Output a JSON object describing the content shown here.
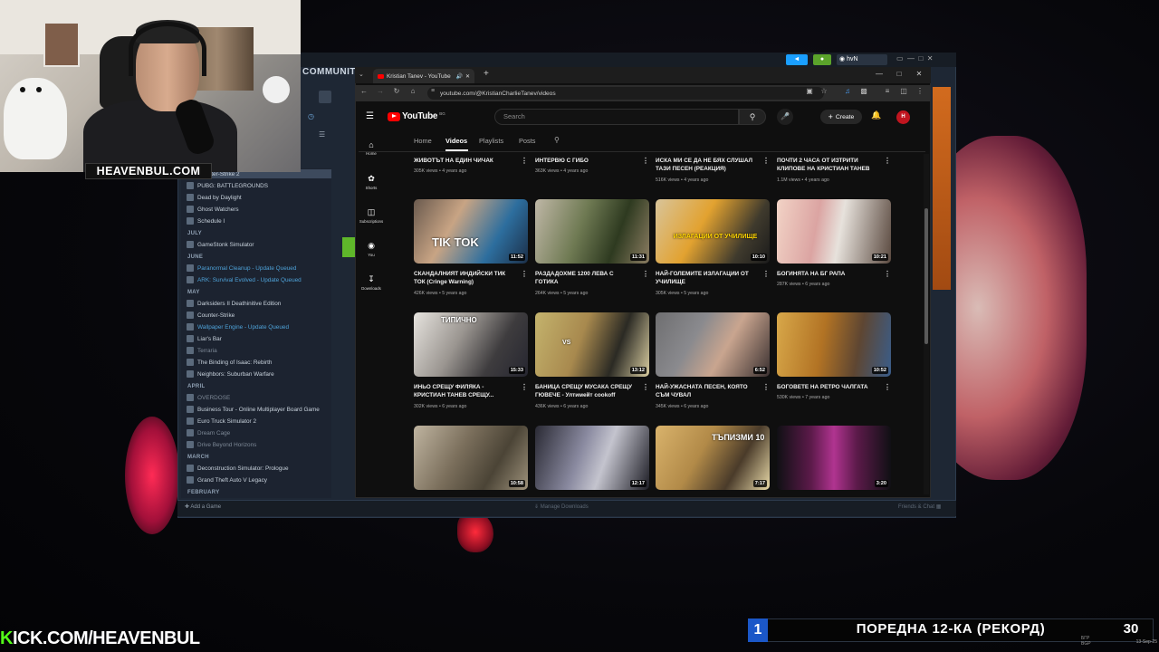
{
  "steam": {
    "top_label": "COMMUNITY",
    "top_label_2": "H",
    "tray_user": "hvN",
    "add_game": "Add a Game",
    "manage_downloads": "Manage Downloads",
    "friends_chat": "Friends & Chat",
    "sections": {
      "july": "JULY",
      "june": "JUNE",
      "may": "MAY",
      "april": "APRIL",
      "march": "MARCH",
      "february": "FEBRUARY"
    },
    "games": [
      {
        "label": "Counter-Strike 2"
      },
      {
        "label": "PUBG: BATTLEGROUNDS"
      },
      {
        "label": "Dead by Daylight"
      },
      {
        "label": "Ghost Watchers"
      },
      {
        "label": "Schedule I"
      },
      {
        "label": "GameStonk Simulator"
      },
      {
        "label": "Paranormal Cleanup - Update Queued"
      },
      {
        "label": "ARK: Survival Evolved - Update Queued"
      },
      {
        "label": "Darksiders II Deathinitive Edition"
      },
      {
        "label": "Counter-Strike"
      },
      {
        "label": "Wallpaper Engine - Update Queued"
      },
      {
        "label": "Liar's Bar"
      },
      {
        "label": "Terraria"
      },
      {
        "label": "The Binding of Isaac: Rebirth"
      },
      {
        "label": "Neighbors: Suburban Warfare"
      },
      {
        "label": "OVERDOSE"
      },
      {
        "label": "Business Tour - Online Multiplayer Board Game"
      },
      {
        "label": "Euro Truck Simulator 2"
      },
      {
        "label": "Dream Cage"
      },
      {
        "label": "Drive Beyond Horizons"
      },
      {
        "label": "Deconstruction Simulator: Prologue"
      },
      {
        "label": "Grand Theft Auto V Legacy"
      }
    ]
  },
  "browser": {
    "tab_title": "Kristian Tanev - YouTube",
    "url": "youtube.com/@KristianCharlieTanev/videos"
  },
  "youtube": {
    "logo_text": "YouTube",
    "country": "BG",
    "search_placeholder": "Search",
    "create_label": "Create",
    "avatar_letter": "H",
    "rail": {
      "home": "Home",
      "shorts": "Shorts",
      "subscriptions": "Subscriptions",
      "you": "You",
      "downloads": "Downloads"
    },
    "tabs": {
      "home": "Home",
      "videos": "Videos",
      "playlists": "Playlists",
      "posts": "Posts"
    },
    "top_row": [
      {
        "title": "ЖИВОТЪТ НА ЕДИН ЧИЧАК",
        "meta": "305K views • 4 years ago"
      },
      {
        "title": "ИНТЕРВЮ С ГИБО",
        "meta": "363K views • 4 years ago"
      },
      {
        "title": "ИСКА МИ СЕ ДА НЕ БЯХ СЛУШАЛ ТАЗИ ПЕСЕН (РЕАКЦИЯ)",
        "meta": "516K views • 4 years ago"
      },
      {
        "title": "ПОЧТИ 2 ЧАСА ОТ ИЗТРИТИ КЛИПОВЕ НА КРИСТИАН ТАНЕВ",
        "meta": "1.1M views • 4 years ago"
      }
    ],
    "row2": [
      {
        "title": "СКАНДАЛНИЯТ ИНДИЙСКИ ТИК ТОК (Cringe Warning)",
        "meta": "426K views • 5 years ago",
        "duration": "11:52",
        "thumb_text": "TIK TOK"
      },
      {
        "title": "РАЗДАДОХМЕ 1200 ЛЕВА С ГОТИКА",
        "meta": "264K views • 5 years ago",
        "duration": "11:31",
        "thumb_text": ""
      },
      {
        "title": "НАЙ-ГОЛЕМИТЕ ИЗЛАГАЦИИ ОТ УЧИЛИЩЕ",
        "meta": "305K views • 5 years ago",
        "duration": "10:10",
        "thumb_text": "ИЗЛАГАЦИИ ОТ УЧИЛИЩЕ"
      },
      {
        "title": "БОГИНЯТА НА БГ РАПА",
        "meta": "287K views • 6 years ago",
        "duration": "10:21",
        "thumb_text": ""
      }
    ],
    "row3": [
      {
        "title": "ИНЬО СРЕЩУ ФИЛЯКА - КРИСТИАН ТАНЕВ СРЕЩУ...",
        "meta": "302K views • 6 years ago",
        "duration": "15:33",
        "thumb_text": "ТИПИЧНО"
      },
      {
        "title": "БАНИЦА СРЕЩУ МУСАКА СРЕЩУ ГЮВЕЧЕ - Ултимейт cookoff",
        "meta": "436K views • 6 years ago",
        "duration": "13:12",
        "thumb_text": "VS"
      },
      {
        "title": "НАЙ-УЖАСНАТА ПЕСЕН, КОЯТО СЪМ ЧУВАЛ",
        "meta": "345K views • 6 years ago",
        "duration": "6:52",
        "thumb_text": ""
      },
      {
        "title": "БОГОВЕТЕ НА РЕТРО ЧАЛГАТА",
        "meta": "530K views • 7 years ago",
        "duration": "10:52",
        "thumb_text": ""
      }
    ],
    "row4": [
      {
        "duration": "10:58",
        "thumb_text": ""
      },
      {
        "duration": "12:17",
        "thumb_text": ""
      },
      {
        "duration": "7:17",
        "thumb_text": "ТЪПИЗМИ 10"
      },
      {
        "duration": "3:20",
        "thumb_text": ""
      }
    ]
  },
  "overlay": {
    "webcam_label": "HEAVENBUL.COM",
    "kick_k": "K",
    "kick_rest": "ICK.COM/HEAVENBUL",
    "counter_left": "1",
    "counter_title": "ПОРЕДНА 12-КА (РЕКОРД)",
    "counter_right": "30",
    "taskbar_lang": "БГР",
    "taskbar_lang2": "BGP",
    "taskbar_date": "13-Sep-25"
  },
  "colors": {
    "youtube_red": "#ff0000",
    "kick_green": "#53fc18",
    "counter_blue": "#1b57c8",
    "steam_bg": "#1e2734"
  }
}
